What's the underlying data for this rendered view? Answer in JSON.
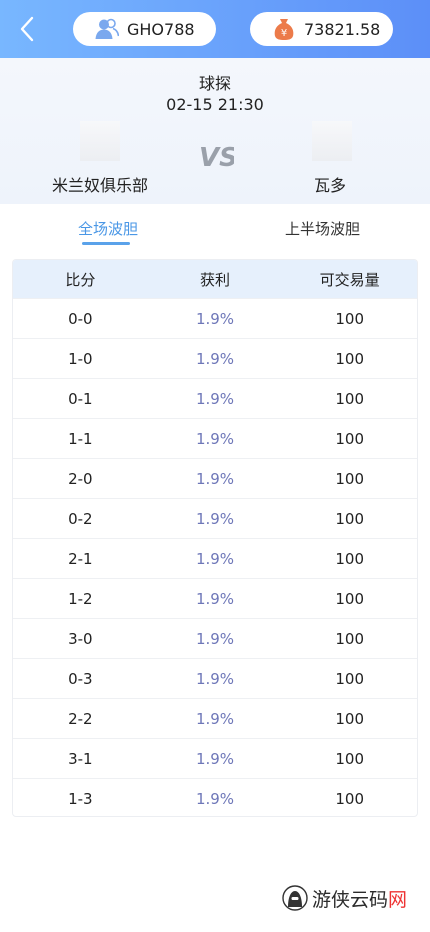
{
  "header": {
    "username": "GHO788",
    "balance": "73821.58",
    "back_icon": "chevron-left-icon",
    "user_icon": "users-icon",
    "money_icon": "money-bag-icon",
    "accent": "#5c8ff8"
  },
  "match": {
    "league": "球探",
    "datetime": "02-15 21:30",
    "home_team": "米兰奴俱乐部",
    "away_team": "瓦多",
    "vs_label": "VS"
  },
  "tabs": [
    {
      "label": "全场波胆",
      "active": true
    },
    {
      "label": "上半场波胆",
      "active": false
    }
  ],
  "table": {
    "headers": [
      "比分",
      "获利",
      "可交易量"
    ],
    "rows": [
      {
        "score": "0-0",
        "profit": "1.9%",
        "volume": "100"
      },
      {
        "score": "1-0",
        "profit": "1.9%",
        "volume": "100"
      },
      {
        "score": "0-1",
        "profit": "1.9%",
        "volume": "100"
      },
      {
        "score": "1-1",
        "profit": "1.9%",
        "volume": "100"
      },
      {
        "score": "2-0",
        "profit": "1.9%",
        "volume": "100"
      },
      {
        "score": "0-2",
        "profit": "1.9%",
        "volume": "100"
      },
      {
        "score": "2-1",
        "profit": "1.9%",
        "volume": "100"
      },
      {
        "score": "1-2",
        "profit": "1.9%",
        "volume": "100"
      },
      {
        "score": "3-0",
        "profit": "1.9%",
        "volume": "100"
      },
      {
        "score": "0-3",
        "profit": "1.9%",
        "volume": "100"
      },
      {
        "score": "2-2",
        "profit": "1.9%",
        "volume": "100"
      },
      {
        "score": "3-1",
        "profit": "1.9%",
        "volume": "100"
      },
      {
        "score": "1-3",
        "profit": "1.9%",
        "volume": "100"
      }
    ]
  },
  "watermark": {
    "text_main": "游侠云码",
    "text_red": "网"
  }
}
